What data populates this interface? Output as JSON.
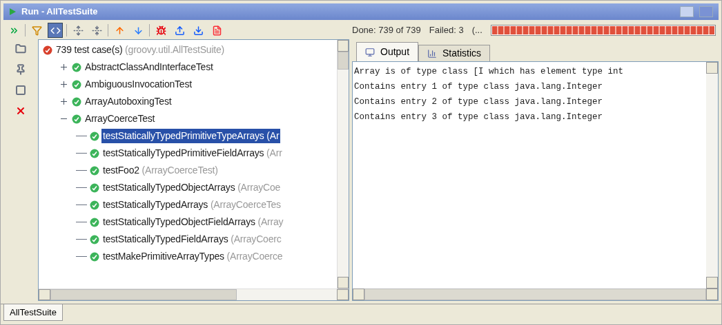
{
  "window": {
    "title": "Run - AllTestSuite"
  },
  "toolbar": [
    {
      "kind": "rerun",
      "pressed": false
    },
    {
      "kind": "filter",
      "pressed": false
    },
    {
      "kind": "scroll",
      "pressed": true
    },
    {
      "kind": "expand",
      "pressed": false
    },
    {
      "kind": "collapse",
      "pressed": false
    },
    {
      "kind": "up",
      "pressed": false
    },
    {
      "kind": "down",
      "pressed": false
    },
    {
      "kind": "bug",
      "pressed": false
    },
    {
      "kind": "export",
      "pressed": false
    },
    {
      "kind": "import",
      "pressed": false
    },
    {
      "kind": "report",
      "pressed": false
    }
  ],
  "side_toolbar": [
    {
      "kind": "folder"
    },
    {
      "kind": "pin"
    },
    {
      "kind": "stop"
    },
    {
      "kind": "close"
    }
  ],
  "status": {
    "done": "Done: 739 of 739",
    "failed": "Failed: 3",
    "extra": "(...",
    "progress": {
      "level": 1,
      "color": "#e0503c"
    }
  },
  "tree": {
    "name": "739 test case(s)",
    "detail": "(groovy.util.AllTestSuite)",
    "failed": true,
    "selected": false,
    "children": [
      {
        "name": "AbstractClassAndInterfaceTest",
        "failed": false,
        "selected": false,
        "expanded": false
      },
      {
        "name": "AmbiguousInvocationTest",
        "failed": false,
        "selected": false,
        "expanded": false
      },
      {
        "name": "ArrayAutoboxingTest",
        "failed": false,
        "selected": false,
        "expanded": false
      },
      {
        "name": "ArrayCoerceTest",
        "failed": false,
        "selected": false,
        "expanded": true,
        "children": [
          {
            "name": "testStaticallyTypedPrimitiveTypeArrays",
            "detail": "(Ar",
            "failed": false,
            "selected": true
          },
          {
            "name": "testStaticallyTypedPrimitiveFieldArrays",
            "detail": "(Arr",
            "failed": false,
            "selected": false
          },
          {
            "name": "testFoo2",
            "detail": "(ArrayCoerceTest)",
            "failed": false,
            "selected": false
          },
          {
            "name": "testStaticallyTypedObjectArrays",
            "detail": "(ArrayCoe",
            "failed": false,
            "selected": false
          },
          {
            "name": "testStaticallyTypedArrays",
            "detail": "(ArrayCoerceTes",
            "failed": false,
            "selected": false
          },
          {
            "name": "testStaticallyTypedObjectFieldArrays",
            "detail": "(Array",
            "failed": false,
            "selected": false
          },
          {
            "name": "testStaticallyTypedFieldArrays",
            "detail": "(ArrayCoerc",
            "failed": false,
            "selected": false
          },
          {
            "name": "testMakePrimitiveArrayTypes",
            "detail": "(ArrayCoerce",
            "failed": false,
            "selected": false
          }
        ]
      }
    ]
  },
  "output_tabs": [
    {
      "label": "Output",
      "selected": true
    },
    {
      "label": "Statistics",
      "selected": false
    }
  ],
  "output_lines": [
    "Array is of type class [I which has element type int",
    "Contains entry 1 of type class java.lang.Integer",
    "Contains entry 2 of type class java.lang.Integer",
    "Contains entry 3 of type class java.lang.Integer"
  ],
  "bottom_tabs": [
    {
      "label": "AllTestSuite",
      "selected": true
    }
  ]
}
